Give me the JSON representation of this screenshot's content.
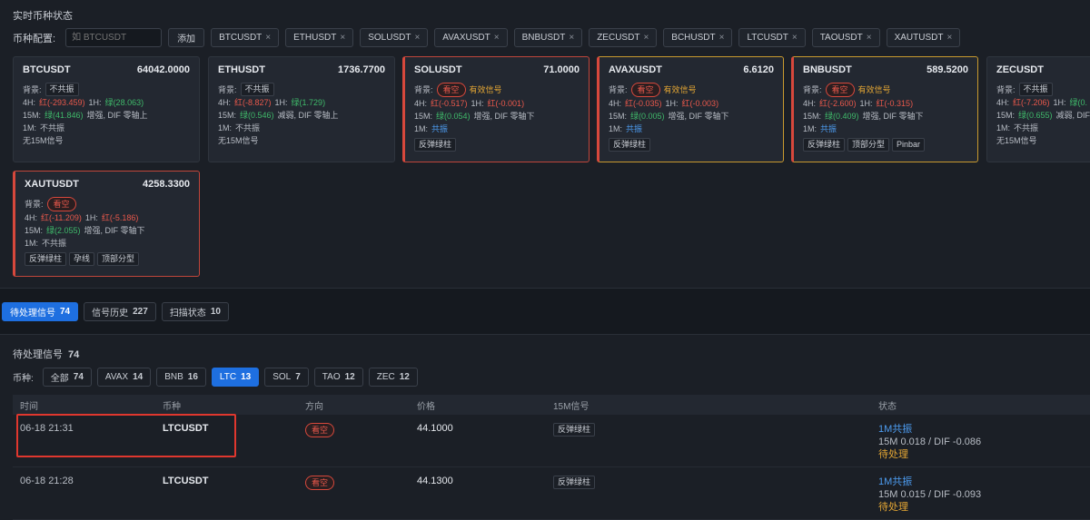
{
  "top": {
    "title": "实时币种状态",
    "config_label": "币种配置:",
    "search_placeholder": "如 BTCUSDT",
    "add_label": "添加",
    "chips": [
      "BTCUSDT",
      "ETHUSDT",
      "SOLUSDT",
      "AVAXUSDT",
      "BNBUSDT",
      "ZECUSDT",
      "BCHUSDT",
      "LTCUSDT",
      "TAOUSDT",
      "XAUTUSDT"
    ],
    "chip_close": "×"
  },
  "cards": [
    {
      "symbol": "BTCUSDT",
      "price": "64042.0000",
      "bg_label": "背景:",
      "bg": "不共振",
      "l4h": "4H:",
      "v4h": "红(-293.459)",
      "c4h": "red",
      "l1h": "1H:",
      "v1h": "绿(28.063)",
      "c1h": "green",
      "l15": "15M:",
      "v15": "绿(41.846)",
      "c15": "green",
      "s15": "增强, DIF 零轴上",
      "l1m": "1M:",
      "v1m": "不共振",
      "c1m": "plain",
      "extra": "无15M信号",
      "tags": []
    },
    {
      "symbol": "ETHUSDT",
      "price": "1736.7700",
      "bg_label": "背景:",
      "bg": "不共振",
      "l4h": "4H:",
      "v4h": "红(-8.827)",
      "c4h": "red",
      "l1h": "1H:",
      "v1h": "绿(1.729)",
      "c1h": "green",
      "l15": "15M:",
      "v15": "绿(0.546)",
      "c15": "green",
      "s15": "减弱, DIF 零轴上",
      "l1m": "1M:",
      "v1m": "不共振",
      "c1m": "plain",
      "extra": "无15M信号",
      "tags": []
    },
    {
      "symbol": "SOLUSDT",
      "price": "71.0000",
      "bg_label": "背景:",
      "bg": "看空",
      "eff": "有效信号",
      "l4h": "4H:",
      "v4h": "红(-0.517)",
      "c4h": "red",
      "l1h": "1H:",
      "v1h": "红(-0.001)",
      "c1h": "red",
      "l15": "15M:",
      "v15": "绿(0.054)",
      "c15": "green",
      "s15": "增强, DIF 零轴下",
      "l1m": "1M:",
      "v1m": "共振",
      "c1m": "blue",
      "tags": [
        "反弹绿柱"
      ]
    },
    {
      "symbol": "AVAXUSDT",
      "price": "6.6120",
      "bg_label": "背景:",
      "bg": "看空",
      "eff": "有效信号",
      "l4h": "4H:",
      "v4h": "红(-0.035)",
      "c4h": "red",
      "l1h": "1H:",
      "v1h": "红(-0.003)",
      "c1h": "red",
      "l15": "15M:",
      "v15": "绿(0.005)",
      "c15": "green",
      "s15": "增强, DIF 零轴下",
      "l1m": "1M:",
      "v1m": "共振",
      "c1m": "blue",
      "tags": [
        "反弹绿柱"
      ]
    },
    {
      "symbol": "BNBUSDT",
      "price": "589.5200",
      "bg_label": "背景:",
      "bg": "看空",
      "eff": "有效信号",
      "l4h": "4H:",
      "v4h": "红(-2.600)",
      "c4h": "red",
      "l1h": "1H:",
      "v1h": "红(-0.315)",
      "c1h": "red",
      "l15": "15M:",
      "v15": "绿(0.409)",
      "c15": "green",
      "s15": "增强, DIF 零轴下",
      "l1m": "1M:",
      "v1m": "共振",
      "c1m": "blue",
      "tags": [
        "反弹绿柱",
        "顶部分型",
        "Pinbar"
      ]
    },
    {
      "symbol": "ZECUSDT",
      "price": "",
      "bg_label": "背景:",
      "bg": "不共振",
      "l4h": "4H:",
      "v4h": "红(-7.206)",
      "c4h": "red",
      "l1h": "1H:",
      "v1h": "绿(0.",
      "c1h": "green",
      "l15": "15M:",
      "v15": "绿(0.655)",
      "c15": "green",
      "s15": "减弱, DIF 零",
      "l1m": "1M:",
      "v1m": "不共振",
      "c1m": "plain",
      "extra": "无15M信号",
      "tags": []
    },
    {
      "symbol": "XAUTUSDT",
      "price": "4258.3300",
      "bg_label": "背景:",
      "bg": "看空",
      "l4h": "4H:",
      "v4h": "红(-11.209)",
      "c4h": "red",
      "l1h": "1H:",
      "v1h": "红(-5.186)",
      "c1h": "red",
      "l15": "15M:",
      "v15": "绿(2.055)",
      "c15": "green",
      "s15": "增强, DIF 零轴下",
      "l1m": "1M:",
      "v1m": "不共振",
      "c1m": "plain",
      "tags": [
        "反弹绿柱",
        "孕线",
        "顶部分型"
      ]
    }
  ],
  "tabs": [
    {
      "label": "待处理信号",
      "count": "74",
      "active": true
    },
    {
      "label": "信号历史",
      "count": "227",
      "active": false
    },
    {
      "label": "扫描状态",
      "count": "10",
      "active": false
    }
  ],
  "pending": {
    "title": "待处理信号",
    "count": "74",
    "filter_label": "币种:",
    "filters": [
      {
        "label": "全部",
        "count": "74",
        "active": false
      },
      {
        "label": "AVAX",
        "count": "14",
        "active": false
      },
      {
        "label": "BNB",
        "count": "16",
        "active": false
      },
      {
        "label": "LTC",
        "count": "13",
        "active": true
      },
      {
        "label": "SOL",
        "count": "7",
        "active": false
      },
      {
        "label": "TAO",
        "count": "12",
        "active": false
      },
      {
        "label": "ZEC",
        "count": "12",
        "active": false
      }
    ],
    "headers": {
      "time": "时间",
      "coin": "币种",
      "dir": "方向",
      "price": "价格",
      "sig": "15M信号",
      "status": "状态"
    },
    "rows": [
      {
        "time": "06-18 21:31",
        "coin": "LTCUSDT",
        "dir": "看空",
        "price": "44.1000",
        "sig": "反弹绿柱",
        "s1": "1M共振",
        "s2": "15M 0.018 / DIF -0.086",
        "s3": "待处理"
      },
      {
        "time": "06-18 21:28",
        "coin": "LTCUSDT",
        "dir": "看空",
        "price": "44.1300",
        "sig": "反弹绿柱",
        "s1": "1M共振",
        "s2": "15M 0.015 / DIF -0.093",
        "s3": "待处理"
      }
    ]
  },
  "colors": {
    "accent": "#1e6fe0",
    "red": "#e8584b",
    "green": "#3fb96a",
    "orange": "#e3a634",
    "blue": "#4d9cf0"
  }
}
